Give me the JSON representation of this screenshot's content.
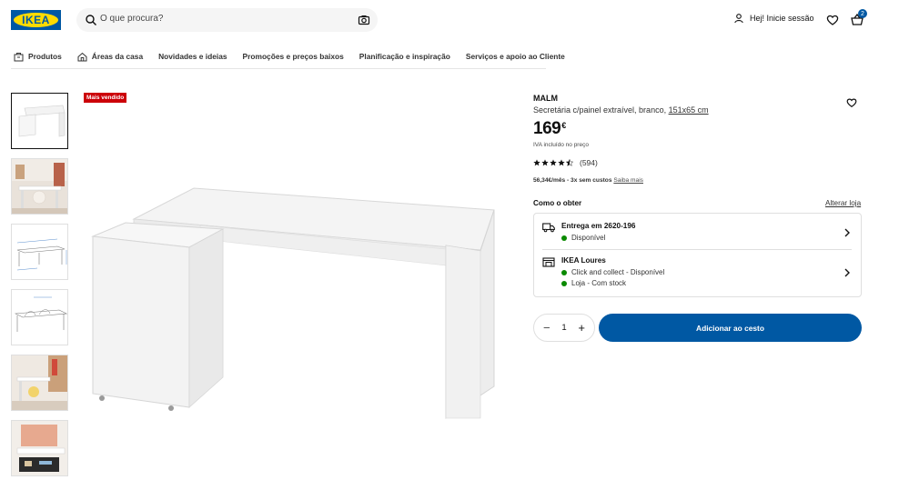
{
  "header": {
    "logo_text": "IKEA",
    "search": {
      "placeholder": "O que procura?",
      "search_icon": "search-icon",
      "camera_icon": "camera-icon"
    },
    "login_label": "Hej! Inicie sessão",
    "basket_count": "2",
    "icons": {
      "user": "user-icon",
      "wishlist": "heart-icon",
      "basket": "basket-icon"
    }
  },
  "nav": {
    "items": [
      {
        "label": "Produtos",
        "icon": "products-icon"
      },
      {
        "label": "Áreas da casa",
        "icon": "home-icon"
      },
      {
        "label": "Novidades e ideias"
      },
      {
        "label": "Promoções e preços baixos"
      },
      {
        "label": "Planificação e inspiração"
      },
      {
        "label": "Serviços e apoio ao Cliente"
      }
    ]
  },
  "gallery": {
    "badge": "Mais vendido",
    "thumbnail_count": 6,
    "active_index": 0
  },
  "product": {
    "name": "MALM",
    "description": "Secretária c/painel extraível, branco, ",
    "dimensions": "151x65 cm",
    "price_integer": "169",
    "price_currency": "€",
    "vat_note": "IVA incluído no preço",
    "rating": {
      "value": 4.5,
      "max": 5,
      "count_label": "(594)"
    },
    "finance": {
      "bold": "56,34€/mês - 3x sem custos",
      "link": "Saiba mais"
    }
  },
  "availability": {
    "heading": "Como o obter",
    "change_store": "Alterar loja",
    "delivery": {
      "title": "Entrega em 2620-196",
      "status": "Disponível",
      "icon": "truck-icon"
    },
    "store": {
      "title": "IKEA Loures",
      "lines": [
        "Click and collect - Disponível",
        "Loja - Com stock"
      ],
      "icon": "store-icon"
    },
    "status_color": "#0a8a00"
  },
  "purchase": {
    "quantity": "1",
    "minus": "−",
    "plus": "+",
    "add_label": "Adicionar ao cesto"
  },
  "colors": {
    "brand_blue": "#0058a3",
    "brand_yellow": "#ffdb00",
    "badge_red": "#cc0008"
  }
}
